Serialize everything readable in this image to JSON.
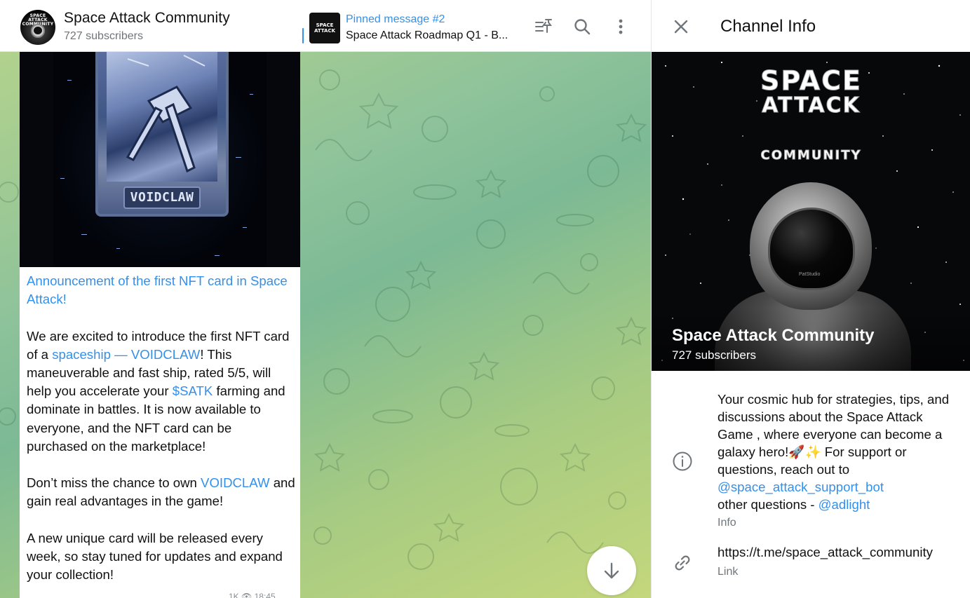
{
  "chat": {
    "header": {
      "title": "Space Attack Community",
      "subscribers": "727 subscribers",
      "avatar_text": "SPACE ATTACK COMMUNITY"
    },
    "pinned": {
      "label": "Pinned message #2",
      "text": "Space Attack Roadmap Q1 - B...",
      "thumb_text": "SPACE ATTACK"
    },
    "icons": {
      "pinned_list": "pinned-list-icon",
      "search": "search-icon",
      "more": "more-vertical-icon",
      "scroll_down": "arrow-down-icon"
    },
    "message": {
      "image_card_name": "VOIDCLAW",
      "headline": "Announcement of the first NFT card in Space Attack!",
      "p1_a": "We are excited to introduce the first NFT card of a ",
      "p1_link": "spaceship — VOIDCLAW",
      "p1_b": "! This maneuverable and fast ship, rated 5/5, will help you accelerate your ",
      "p1_link2": "$SATK",
      "p1_c": " farming and dominate in battles. It is now available to everyone, and the NFT card can be purchased on the marketplace!",
      "p2_a": "Don’t miss the chance to own ",
      "p2_link": "VOIDCLAW",
      "p2_b": " and gain real advantages in the game!",
      "p3": "A new unique card will be released every week, so stay tuned for updates and expand your collection!",
      "views": "1K",
      "time": "18:45"
    },
    "colors": {
      "accent": "#3390ec",
      "secondary_text": "#707579"
    }
  },
  "info": {
    "title": "Channel Info",
    "cover": {
      "logo_line1": "SPACE",
      "logo_line2": "ATTACK",
      "logo_line3": "COMMUNITY",
      "brand": "PatStudio",
      "name": "Space Attack Community",
      "subscribers": "727 subscribers"
    },
    "about": {
      "text_a": "Your cosmic hub for strategies, tips, and discussions about the Space Attack Game , where everyone can become a galaxy hero!🚀✨ For support or questions, reach out to ",
      "mention1": "@space_attack_support_bot",
      "text_b": "other questions - ",
      "mention2": "@adlight",
      "caption": "Info"
    },
    "link": {
      "url": "https://t.me/space_attack_community",
      "caption": "Link"
    }
  }
}
